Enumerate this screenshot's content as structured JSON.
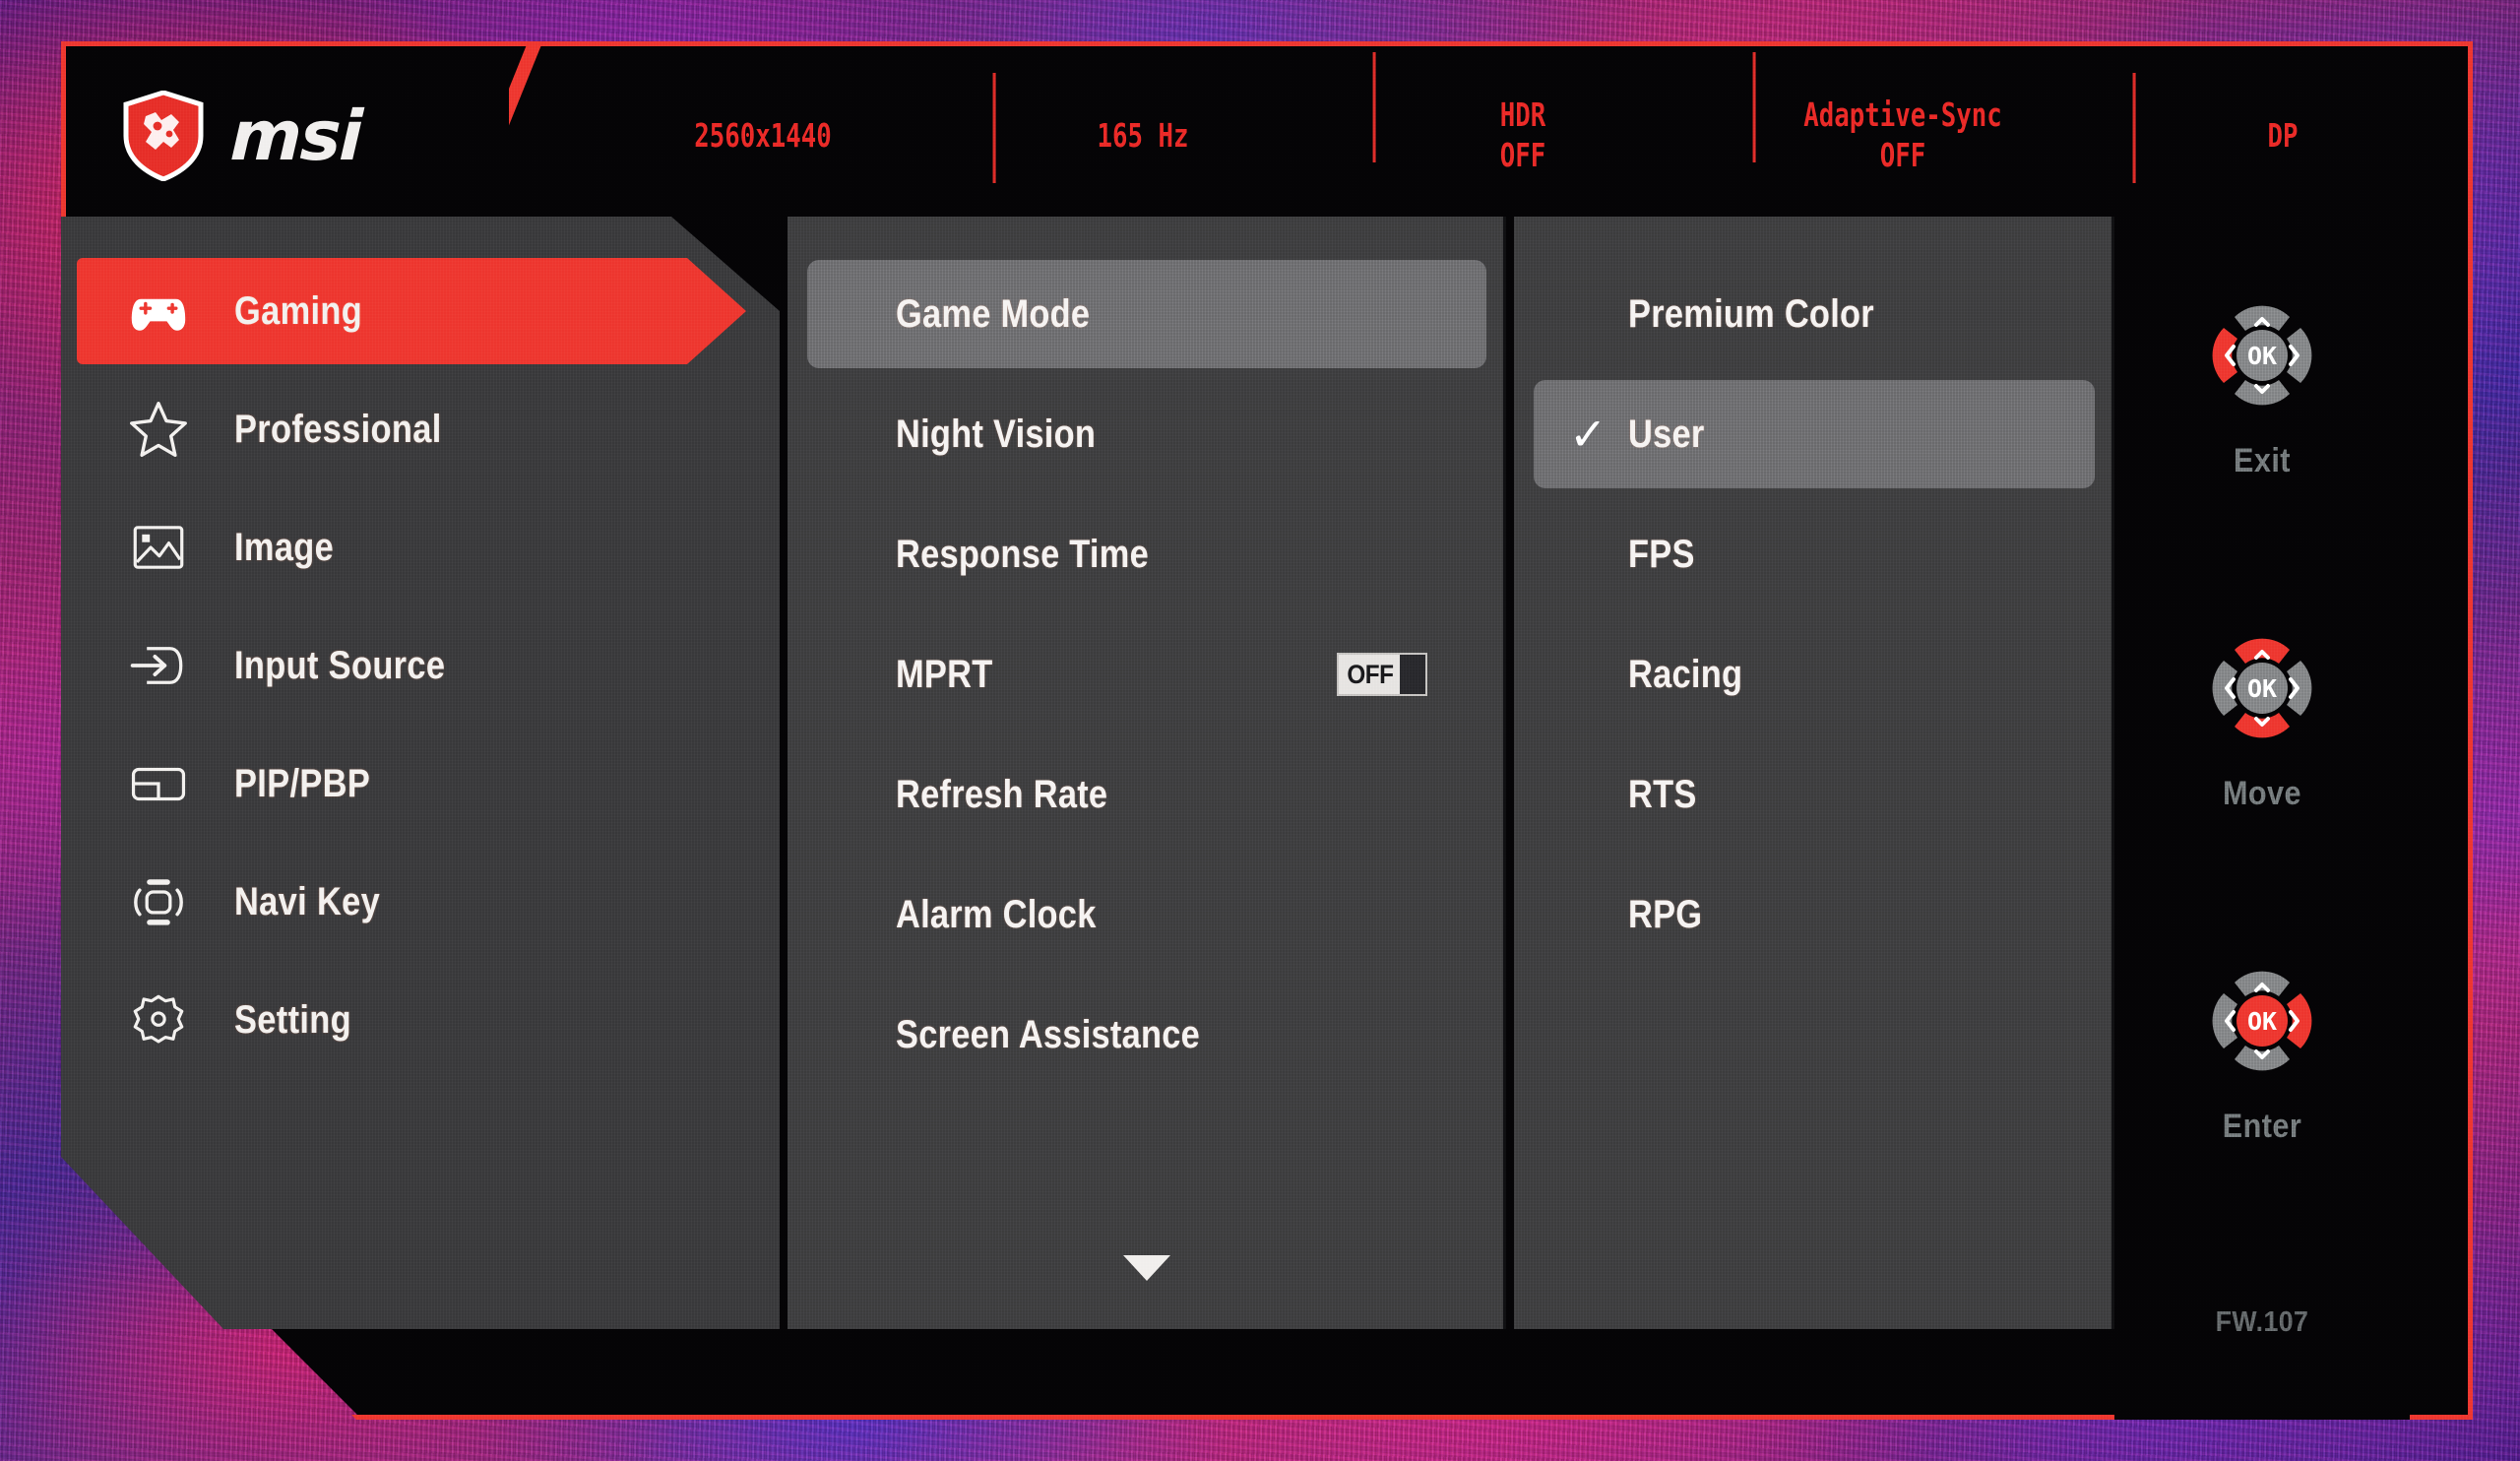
{
  "brand": {
    "logo_icon": "msi-dragon-shield-icon",
    "wordmark": "msi"
  },
  "status_bar": {
    "items": [
      {
        "main": "2560x1440",
        "sub": ""
      },
      {
        "main": "165 Hz",
        "sub": ""
      },
      {
        "main": "HDR",
        "sub": "OFF"
      },
      {
        "main": "Adaptive-Sync",
        "sub": "OFF"
      },
      {
        "main": "DP",
        "sub": ""
      }
    ]
  },
  "sidebar": {
    "items": [
      {
        "label": "Gaming",
        "icon": "gamepad-icon",
        "active": true
      },
      {
        "label": "Professional",
        "icon": "star-icon",
        "active": false
      },
      {
        "label": "Image",
        "icon": "picture-icon",
        "active": false
      },
      {
        "label": "Input Source",
        "icon": "input-arrow-icon",
        "active": false
      },
      {
        "label": "PIP/PBP",
        "icon": "pip-pbp-icon",
        "active": false
      },
      {
        "label": "Navi Key",
        "icon": "navi-key-icon",
        "active": false
      },
      {
        "label": "Setting",
        "icon": "gear-icon",
        "active": false
      }
    ]
  },
  "submenu": {
    "items": [
      {
        "label": "Game Mode",
        "selected": true,
        "toggle": null
      },
      {
        "label": "Night Vision",
        "selected": false,
        "toggle": null
      },
      {
        "label": "Response Time",
        "selected": false,
        "toggle": null
      },
      {
        "label": "MPRT",
        "selected": false,
        "toggle": "OFF"
      },
      {
        "label": "Refresh Rate",
        "selected": false,
        "toggle": null
      },
      {
        "label": "Alarm Clock",
        "selected": false,
        "toggle": null
      },
      {
        "label": "Screen Assistance",
        "selected": false,
        "toggle": null
      }
    ],
    "scroll_more_icon": "chevron-down-icon"
  },
  "options": {
    "items": [
      {
        "label": "Premium Color",
        "selected": false,
        "checked": false
      },
      {
        "label": "User",
        "selected": true,
        "checked": true
      },
      {
        "label": "FPS",
        "selected": false,
        "checked": false
      },
      {
        "label": "Racing",
        "selected": false,
        "checked": false
      },
      {
        "label": "RTS",
        "selected": false,
        "checked": false
      },
      {
        "label": "RPG",
        "selected": false,
        "checked": false
      }
    ],
    "check_glyph": "✓"
  },
  "nav_hints": {
    "groups": [
      {
        "label": "Exit",
        "icon": "dpad-left-icon",
        "highlight": "left"
      },
      {
        "label": "Move",
        "icon": "dpad-updown-icon",
        "highlight": "updown"
      },
      {
        "label": "Enter",
        "icon": "dpad-ok-icon",
        "highlight": "ok"
      }
    ],
    "ok_label": "OK"
  },
  "firmware": {
    "version": "FW.107"
  },
  "colors": {
    "accent_red": "#ef3b33",
    "status_red": "#ec2d2a",
    "panel_gray": "#434345",
    "sidebar_gray": "#3f3f41",
    "highlight_gray": "#77777a",
    "osd_black": "#050406",
    "text_white": "#f6f4f3",
    "hint_gray": "#7e8486"
  }
}
